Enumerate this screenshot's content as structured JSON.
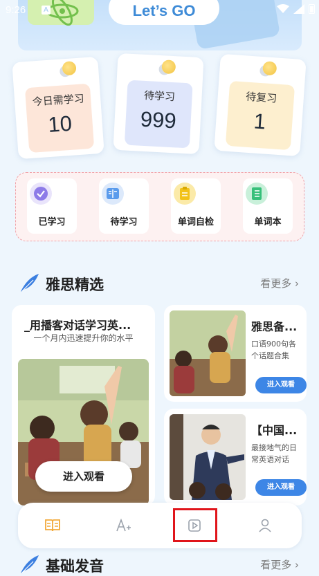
{
  "status_bar": {
    "time": "9:26",
    "notification_glyph": "A"
  },
  "banner": {
    "title": "Let’s GO"
  },
  "stats": [
    {
      "label": "今日需学习",
      "value": "10"
    },
    {
      "label": "待学习",
      "value": "999"
    },
    {
      "label": "待复习",
      "value": "1"
    }
  ],
  "quick_actions": [
    {
      "label": "已学习",
      "icon": "check-circle-icon",
      "color": "#8d7be8"
    },
    {
      "label": "待学习",
      "icon": "book-open-icon",
      "color": "#5a9bec"
    },
    {
      "label": "单词自检",
      "icon": "clipboard-icon",
      "color": "#f2c21a"
    },
    {
      "label": "单词本",
      "icon": "notebook-icon",
      "color": "#36c07a"
    }
  ],
  "section_ielts": {
    "title": "雅思精选",
    "more": "看更多"
  },
  "featured_course": {
    "title": "_用播客对话学习英...",
    "subtitle": "一个月内迅速提升你的水平",
    "button": "进入观看"
  },
  "course_cards": [
    {
      "title": "雅思备...",
      "desc": "口语900句各个话题合集",
      "button": "进入观看"
    },
    {
      "title": "【中国...",
      "desc": "最接地气的日常英语对话",
      "button": "进入观看"
    }
  ],
  "section_pronunciation": {
    "title": "基础发音",
    "more": "看更多"
  },
  "tab_bar": {
    "items": [
      "book-tab-icon",
      "font-tab-icon",
      "video-tab-icon",
      "profile-tab-icon"
    ],
    "active_color": "#f2a93b"
  }
}
